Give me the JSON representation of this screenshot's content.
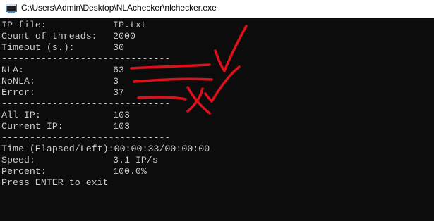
{
  "window": {
    "title": "C:\\Users\\Admin\\Desktop\\NLAchecker\\nlchecker.exe",
    "icon": "console-window-icon"
  },
  "console": {
    "separator": "------------------------------",
    "stats1": [
      {
        "label": "IP file:",
        "value": "IP.txt"
      },
      {
        "label": "Count of threads:",
        "value": "2000"
      },
      {
        "label": "Timeout (s.):",
        "value": "30"
      }
    ],
    "stats2": [
      {
        "label": "NLA:",
        "value": "63"
      },
      {
        "label": "NoNLA:",
        "value": "3"
      },
      {
        "label": "Error:",
        "value": "37"
      }
    ],
    "stats3": [
      {
        "label": "All IP:",
        "value": "103"
      },
      {
        "label": "Current IP:",
        "value": "103"
      }
    ],
    "time_line": "Time (Elapsed/Left):00:00:33/00:00:00",
    "stats4": [
      {
        "label": "Speed:",
        "value": "3.1 IP/s"
      },
      {
        "label": "Percent:",
        "value": "100.0%"
      }
    ],
    "prompt": "Press ENTER to exit"
  },
  "colors": {
    "console_bg": "#0c0c0c",
    "console_text": "#cccccc",
    "annotation_ink": "#e0101a"
  }
}
